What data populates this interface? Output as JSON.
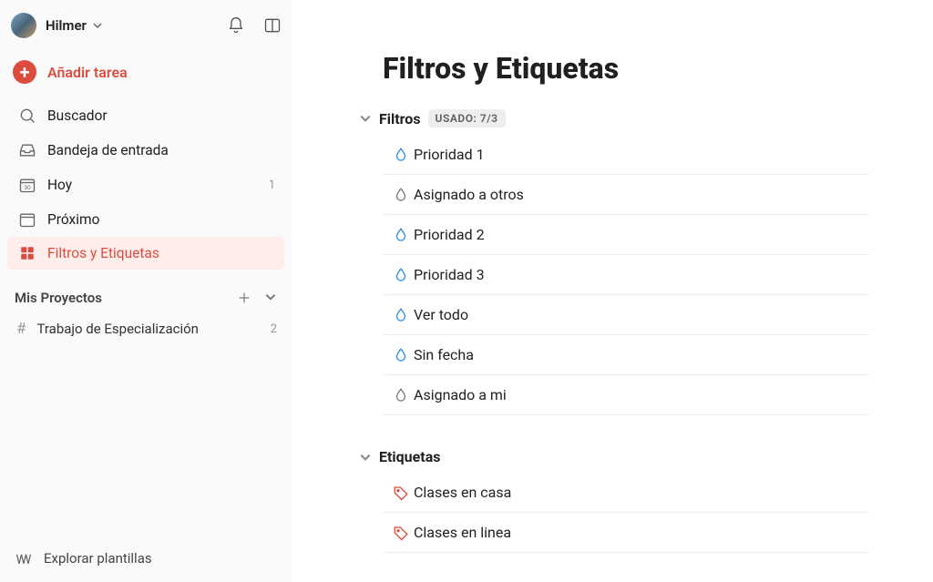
{
  "user": {
    "name": "Hilmer"
  },
  "sidebar": {
    "add_task": "Añadir tarea",
    "nav": [
      {
        "label": "Buscador",
        "count": ""
      },
      {
        "label": "Bandeja de entrada",
        "count": ""
      },
      {
        "label": "Hoy",
        "count": "1"
      },
      {
        "label": "Próximo",
        "count": ""
      },
      {
        "label": "Filtros y Etiquetas",
        "count": ""
      }
    ],
    "projects_title": "Mis Proyectos",
    "projects": [
      {
        "label": "Trabajo de Especialización",
        "count": "2"
      }
    ],
    "footer": "Explorar plantillas"
  },
  "main": {
    "title": "Filtros y Etiquetas",
    "filters_title": "Filtros",
    "filters_badge": "USADO: 7/3",
    "labels_title": "Etiquetas",
    "filters": [
      {
        "label": "Prioridad 1",
        "active": true
      },
      {
        "label": "Asignado a otros",
        "active": false
      },
      {
        "label": "Prioridad 2",
        "active": true
      },
      {
        "label": "Prioridad 3",
        "active": true
      },
      {
        "label": "Ver todo",
        "active": true
      },
      {
        "label": "Sin fecha",
        "active": true
      },
      {
        "label": "Asignado a mi",
        "active": false
      }
    ],
    "labels": [
      {
        "label": "Clases en casa"
      },
      {
        "label": "Clases en linea"
      }
    ]
  },
  "colors": {
    "accent": "#db4c3f",
    "filter_active": "#288ce0",
    "filter_inactive": "#777",
    "tag": "#db4c3f"
  }
}
